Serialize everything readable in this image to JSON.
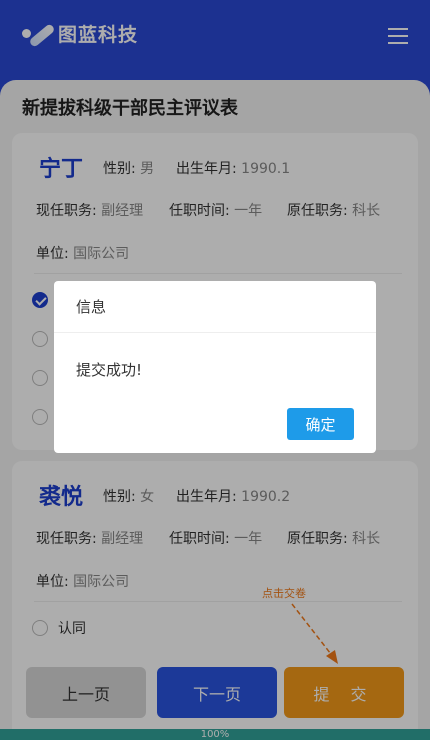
{
  "header": {
    "brand": "图蓝科技"
  },
  "form": {
    "title": "新提拔科级干部民主评议表"
  },
  "candidates": [
    {
      "name": "宁丁",
      "gender_label": "性别:",
      "gender": "男",
      "birth_label": "出生年月:",
      "birth": "1990.1",
      "position_label": "现任职务:",
      "position": "副经理",
      "tenure_label": "任职时间:",
      "tenure": "一年",
      "former_label": "原任职务:",
      "former": "科长",
      "unit_label": "单位:",
      "unit": "国际公司"
    },
    {
      "name": "裘悦",
      "gender_label": "性别:",
      "gender": "女",
      "birth_label": "出生年月:",
      "birth": "1990.2",
      "position_label": "现任职务:",
      "position": "副经理",
      "tenure_label": "任职时间:",
      "tenure": "一年",
      "former_label": "原任职务:",
      "former": "科长",
      "unit_label": "单位:",
      "unit": "国际公司",
      "option_first": "认同"
    }
  ],
  "buttons": {
    "prev": "上一页",
    "next": "下一页",
    "submit": "提 交"
  },
  "hint": "点击交卷",
  "progress": {
    "label": "100%",
    "value": 1.0
  },
  "dialog": {
    "title": "信息",
    "message": "提交成功!",
    "ok": "确定"
  },
  "colors": {
    "brand": "#2a49d4",
    "submit": "#f39a1a",
    "next": "#2a55e0",
    "progress": "#31a39a",
    "confirm": "#1e9be9"
  }
}
